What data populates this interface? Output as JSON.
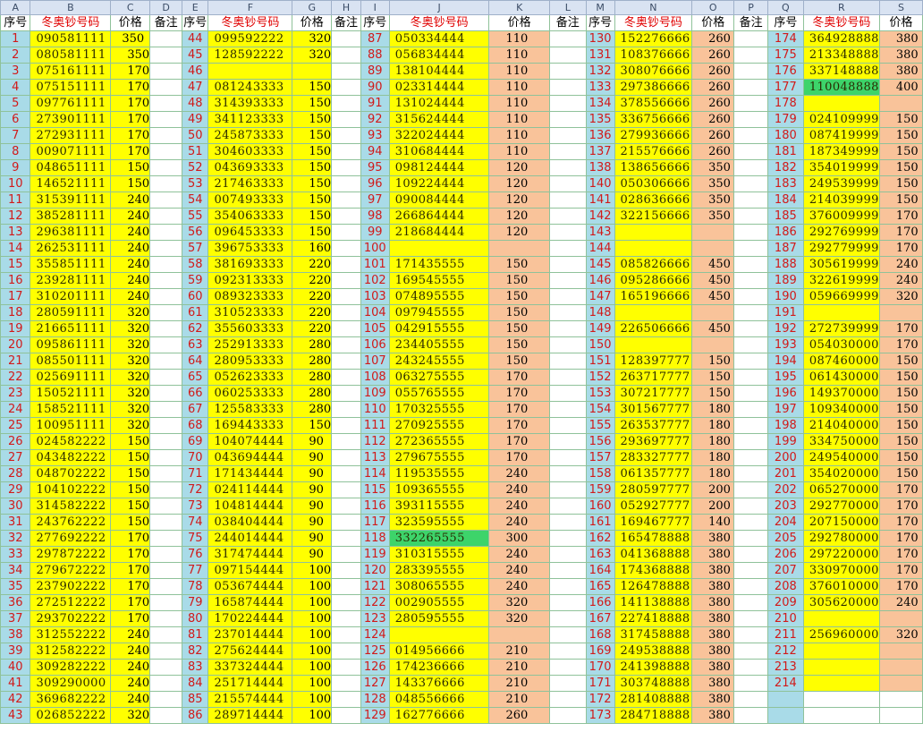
{
  "column_letters": [
    "A",
    "B",
    "C",
    "D",
    "E",
    "F",
    "G",
    "H",
    "I",
    "J",
    "K",
    "L",
    "M",
    "N",
    "O",
    "P",
    "Q",
    "R",
    "S"
  ],
  "headers": {
    "seq": "序号",
    "code": "冬奥钞号码",
    "price": "价格",
    "note": "备注"
  },
  "colors": {
    "seq_bg": "#a9dbe8",
    "seq_text": "#d11a1a",
    "code_bg": "#ffff00",
    "highlight_bg": "#3dd46a",
    "price_bg": "#f9c39a",
    "header_code_text": "#e00000",
    "grid": "#8fc29a"
  },
  "blocks": [
    {
      "rows": [
        [
          "1",
          "090581111",
          "350"
        ],
        [
          "2",
          "080581111",
          "350"
        ],
        [
          "3",
          "075161111",
          "170"
        ],
        [
          "4",
          "075151111",
          "170"
        ],
        [
          "5",
          "097761111",
          "170"
        ],
        [
          "6",
          "273901111",
          "170"
        ],
        [
          "7",
          "272931111",
          "170"
        ],
        [
          "8",
          "009071111",
          "170"
        ],
        [
          "9",
          "048651111",
          "150"
        ],
        [
          "10",
          "146521111",
          "150"
        ],
        [
          "11",
          "315391111",
          "240"
        ],
        [
          "12",
          "385281111",
          "240"
        ],
        [
          "13",
          "296381111",
          "240"
        ],
        [
          "14",
          "262531111",
          "240"
        ],
        [
          "15",
          "355851111",
          "240"
        ],
        [
          "16",
          "239281111",
          "240"
        ],
        [
          "17",
          "310201111",
          "240"
        ],
        [
          "18",
          "280591111",
          "320"
        ],
        [
          "19",
          "216651111",
          "320"
        ],
        [
          "20",
          "095861111",
          "320"
        ],
        [
          "21",
          "085501111",
          "320"
        ],
        [
          "22",
          "025691111",
          "320"
        ],
        [
          "23",
          "150521111",
          "320"
        ],
        [
          "24",
          "158521111",
          "320"
        ],
        [
          "25",
          "100951111",
          "320"
        ],
        [
          "26",
          "024582222",
          "150"
        ],
        [
          "27",
          "043482222",
          "150"
        ],
        [
          "28",
          "048702222",
          "150"
        ],
        [
          "29",
          "104102222",
          "150"
        ],
        [
          "30",
          "314582222",
          "150"
        ],
        [
          "31",
          "243762222",
          "150"
        ],
        [
          "32",
          "277692222",
          "170"
        ],
        [
          "33",
          "297872222",
          "170"
        ],
        [
          "34",
          "279672222",
          "170"
        ],
        [
          "35",
          "237902222",
          "170"
        ],
        [
          "36",
          "272512222",
          "170"
        ],
        [
          "37",
          "293702222",
          "170"
        ],
        [
          "38",
          "312552222",
          "240"
        ],
        [
          "39",
          "312582222",
          "240"
        ],
        [
          "40",
          "309282222",
          "240"
        ],
        [
          "41",
          "309290000",
          "240"
        ],
        [
          "42",
          "369682222",
          "240"
        ],
        [
          "43",
          "026852222",
          "320"
        ]
      ]
    },
    {
      "rows": [
        [
          "44",
          "099592222",
          "320"
        ],
        [
          "45",
          "128592222",
          "320"
        ],
        [
          "46",
          "",
          ""
        ],
        [
          "47",
          "081243333",
          "150"
        ],
        [
          "48",
          "314393333",
          "150"
        ],
        [
          "49",
          "341123333",
          "150"
        ],
        [
          "50",
          "245873333",
          "150"
        ],
        [
          "51",
          "304603333",
          "150"
        ],
        [
          "52",
          "043693333",
          "150"
        ],
        [
          "53",
          "217463333",
          "150"
        ],
        [
          "54",
          "007493333",
          "150"
        ],
        [
          "55",
          "354063333",
          "150"
        ],
        [
          "56",
          "096453333",
          "150"
        ],
        [
          "57",
          "396753333",
          "160"
        ],
        [
          "58",
          "381693333",
          "220"
        ],
        [
          "59",
          "092313333",
          "220"
        ],
        [
          "60",
          "089323333",
          "220"
        ],
        [
          "61",
          "310523333",
          "220"
        ],
        [
          "62",
          "355603333",
          "220"
        ],
        [
          "63",
          "252913333",
          "280"
        ],
        [
          "64",
          "280953333",
          "280"
        ],
        [
          "65",
          "052623333",
          "280"
        ],
        [
          "66",
          "060253333",
          "280"
        ],
        [
          "67",
          "125583333",
          "280"
        ],
        [
          "68",
          "169443333",
          "150"
        ],
        [
          "69",
          "104074444",
          "90"
        ],
        [
          "70",
          "043694444",
          "90"
        ],
        [
          "71",
          "171434444",
          "90"
        ],
        [
          "72",
          "024114444",
          "90"
        ],
        [
          "73",
          "104814444",
          "90"
        ],
        [
          "74",
          "038404444",
          "90"
        ],
        [
          "75",
          "244014444",
          "90"
        ],
        [
          "76",
          "317474444",
          "90"
        ],
        [
          "77",
          "097154444",
          "100"
        ],
        [
          "78",
          "053674444",
          "100"
        ],
        [
          "79",
          "165874444",
          "100"
        ],
        [
          "80",
          "170224444",
          "100"
        ],
        [
          "81",
          "237014444",
          "100"
        ],
        [
          "82",
          "275624444",
          "100"
        ],
        [
          "83",
          "337324444",
          "100"
        ],
        [
          "84",
          "251714444",
          "100"
        ],
        [
          "85",
          "215574444",
          "100"
        ],
        [
          "86",
          "289714444",
          "100"
        ]
      ]
    },
    {
      "rows": [
        [
          "87",
          "050334444",
          "110"
        ],
        [
          "88",
          "056834444",
          "110"
        ],
        [
          "89",
          "138104444",
          "110"
        ],
        [
          "90",
          "023314444",
          "110"
        ],
        [
          "91",
          "131024444",
          "110"
        ],
        [
          "92",
          "315624444",
          "110"
        ],
        [
          "93",
          "322024444",
          "110"
        ],
        [
          "94",
          "310684444",
          "110"
        ],
        [
          "95",
          "098124444",
          "120"
        ],
        [
          "96",
          "109224444",
          "120"
        ],
        [
          "97",
          "090084444",
          "120"
        ],
        [
          "98",
          "266864444",
          "120"
        ],
        [
          "99",
          "218684444",
          "120"
        ],
        [
          "100",
          "",
          ""
        ],
        [
          "101",
          "171435555",
          "150"
        ],
        [
          "102",
          "169545555",
          "150"
        ],
        [
          "103",
          "074895555",
          "150"
        ],
        [
          "104",
          "097945555",
          "150"
        ],
        [
          "105",
          "042915555",
          "150"
        ],
        [
          "106",
          "234405555",
          "150"
        ],
        [
          "107",
          "243245555",
          "150"
        ],
        [
          "108",
          "063275555",
          "170"
        ],
        [
          "109",
          "055765555",
          "170"
        ],
        [
          "110",
          "170325555",
          "170"
        ],
        [
          "111",
          "270925555",
          "170"
        ],
        [
          "112",
          "272365555",
          "170"
        ],
        [
          "113",
          "279675555",
          "170"
        ],
        [
          "114",
          "119535555",
          "240"
        ],
        [
          "115",
          "109365555",
          "240"
        ],
        [
          "116",
          "393115555",
          "240"
        ],
        [
          "117",
          "323595555",
          "240"
        ],
        [
          "118",
          "332265555",
          "300"
        ],
        [
          "119",
          "310315555",
          "240"
        ],
        [
          "120",
          "283395555",
          "240"
        ],
        [
          "121",
          "308065555",
          "240"
        ],
        [
          "122",
          "002905555",
          "320"
        ],
        [
          "123",
          "280595555",
          "320"
        ],
        [
          "124",
          "",
          ""
        ],
        [
          "125",
          "014956666",
          "210"
        ],
        [
          "126",
          "174236666",
          "210"
        ],
        [
          "127",
          "143376666",
          "210"
        ],
        [
          "128",
          "048556666",
          "210"
        ],
        [
          "129",
          "162776666",
          "260"
        ]
      ]
    },
    {
      "rows": [
        [
          "130",
          "152276666",
          "260"
        ],
        [
          "131",
          "108376666",
          "260"
        ],
        [
          "132",
          "308076666",
          "260"
        ],
        [
          "133",
          "297386666",
          "260"
        ],
        [
          "134",
          "378556666",
          "260"
        ],
        [
          "135",
          "336756666",
          "260"
        ],
        [
          "136",
          "279936666",
          "260"
        ],
        [
          "137",
          "215576666",
          "260"
        ],
        [
          "138",
          "138656666",
          "350"
        ],
        [
          "140",
          "050306666",
          "350"
        ],
        [
          "141",
          "028636666",
          "350"
        ],
        [
          "142",
          "322156666",
          "350"
        ],
        [
          "143",
          "",
          ""
        ],
        [
          "144",
          "",
          ""
        ],
        [
          "145",
          "085826666",
          "450"
        ],
        [
          "146",
          "095286666",
          "450"
        ],
        [
          "147",
          "165196666",
          "450"
        ],
        [
          "148",
          "",
          ""
        ],
        [
          "149",
          "226506666",
          "450"
        ],
        [
          "150",
          "",
          ""
        ],
        [
          "151",
          "128397777",
          "150"
        ],
        [
          "152",
          "263717777",
          "150"
        ],
        [
          "153",
          "307217777",
          "150"
        ],
        [
          "154",
          "301567777",
          "180"
        ],
        [
          "155",
          "263537777",
          "180"
        ],
        [
          "156",
          "293697777",
          "180"
        ],
        [
          "157",
          "283327777",
          "180"
        ],
        [
          "158",
          "061357777",
          "180"
        ],
        [
          "159",
          "280597777",
          "200"
        ],
        [
          "160",
          "052927777",
          "200"
        ],
        [
          "161",
          "169467777",
          "140"
        ],
        [
          "162",
          "165478888",
          "380"
        ],
        [
          "163",
          "041368888",
          "380"
        ],
        [
          "164",
          "174368888",
          "380"
        ],
        [
          "165",
          "126478888",
          "380"
        ],
        [
          "166",
          "141138888",
          "380"
        ],
        [
          "167",
          "227418888",
          "380"
        ],
        [
          "168",
          "317458888",
          "380"
        ],
        [
          "169",
          "249538888",
          "380"
        ],
        [
          "170",
          "241398888",
          "380"
        ],
        [
          "171",
          "303748888",
          "380"
        ],
        [
          "172",
          "281408888",
          "380"
        ],
        [
          "173",
          "284718888",
          "380"
        ]
      ]
    },
    {
      "rows": [
        [
          "174",
          "364928888",
          "380"
        ],
        [
          "175",
          "213348888",
          "380"
        ],
        [
          "176",
          "337148888",
          "380"
        ],
        [
          "177",
          "110048888",
          "400"
        ],
        [
          "178",
          "",
          ""
        ],
        [
          "179",
          "024109999",
          "150"
        ],
        [
          "180",
          "087419999",
          "150"
        ],
        [
          "181",
          "187349999",
          "150"
        ],
        [
          "182",
          "354019999",
          "150"
        ],
        [
          "183",
          "249539999",
          "150"
        ],
        [
          "184",
          "214039999",
          "150"
        ],
        [
          "185",
          "376009999",
          "170"
        ],
        [
          "186",
          "292769999",
          "170"
        ],
        [
          "187",
          "292779999",
          "170"
        ],
        [
          "188",
          "305619999",
          "240"
        ],
        [
          "189",
          "322619999",
          "240"
        ],
        [
          "190",
          "059669999",
          "320"
        ],
        [
          "191",
          "",
          ""
        ],
        [
          "192",
          "272739999",
          "170"
        ],
        [
          "193",
          "054030000",
          "170"
        ],
        [
          "194",
          "087460000",
          "150"
        ],
        [
          "195",
          "061430000",
          "150"
        ],
        [
          "196",
          "149370000",
          "150"
        ],
        [
          "197",
          "109340000",
          "150"
        ],
        [
          "198",
          "214040000",
          "150"
        ],
        [
          "199",
          "334750000",
          "150"
        ],
        [
          "200",
          "249540000",
          "150"
        ],
        [
          "201",
          "354020000",
          "150"
        ],
        [
          "202",
          "065270000",
          "170"
        ],
        [
          "203",
          "292770000",
          "170"
        ],
        [
          "204",
          "207150000",
          "170"
        ],
        [
          "205",
          "292780000",
          "170"
        ],
        [
          "206",
          "297220000",
          "170"
        ],
        [
          "207",
          "330970000",
          "170"
        ],
        [
          "208",
          "376010000",
          "170"
        ],
        [
          "209",
          "305620000",
          "240"
        ],
        [
          "210",
          "",
          ""
        ],
        [
          "211",
          "256960000",
          "320"
        ],
        [
          "212",
          "",
          ""
        ],
        [
          "213",
          "",
          ""
        ],
        [
          "214",
          "",
          ""
        ],
        [
          "",
          "",
          " "
        ]
      ]
    }
  ]
}
